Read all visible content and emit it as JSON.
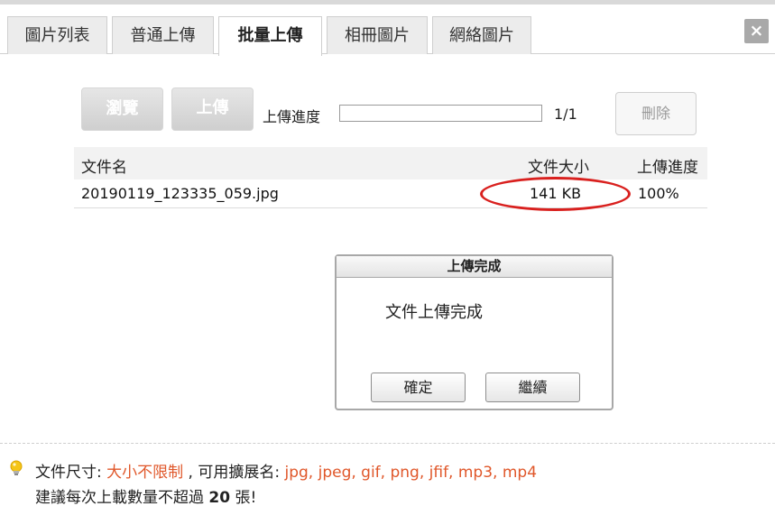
{
  "tabs": [
    {
      "label": "圖片列表",
      "active": false
    },
    {
      "label": "普通上傳",
      "active": false
    },
    {
      "label": "批量上傳",
      "active": true
    },
    {
      "label": "相冊圖片",
      "active": false
    },
    {
      "label": "網絡圖片",
      "active": false
    }
  ],
  "close_label": "×",
  "toolbar": {
    "browse_label": "瀏覽",
    "upload_label": "上傳",
    "progress_label": "上傳進度",
    "progress_count": "1/1",
    "progress_fraction": 1.0,
    "delete_label": "刪除"
  },
  "table": {
    "headers": [
      "文件名",
      "文件大小",
      "上傳進度"
    ],
    "rows": [
      {
        "name": "20190119_123335_059.jpg",
        "size": "141 KB",
        "progress": "100%"
      }
    ]
  },
  "dialog": {
    "title": "上傳完成",
    "message": "文件上傳完成",
    "ok_label": "確定",
    "continue_label": "繼續"
  },
  "footer": {
    "size_label": "文件尺寸: ",
    "size_value": "大小不限制",
    "ext_label": " , 可用擴展名: ",
    "ext_value": "jpg, jpeg, gif, png, jfif, mp3, mp4",
    "suggest_prefix": "建議每次上載數量不超過 ",
    "suggest_count": "20",
    "suggest_suffix": " 張!"
  },
  "colors": {
    "highlight": "#e0572a",
    "annotation": "#d9201e"
  },
  "icons": {
    "tip": "lightbulb-icon",
    "close": "close-icon"
  }
}
